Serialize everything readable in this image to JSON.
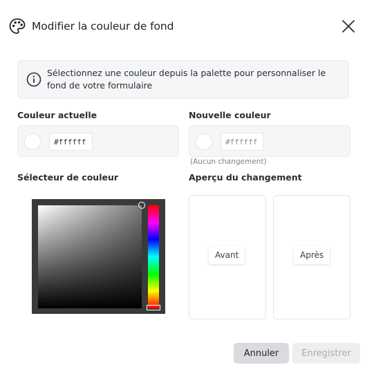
{
  "dialog": {
    "title": "Modifier la couleur de fond",
    "info_text": "Sélectionnez une couleur depuis la palette pour personnaliser le fond de votre formulaire",
    "icons": {
      "title": "palette-icon",
      "close": "close-icon",
      "info": "info-icon"
    }
  },
  "current": {
    "label": "Couleur actuelle",
    "hex": "#ffffff",
    "swatch_color": "#ffffff"
  },
  "new": {
    "label": "Nouvelle couleur",
    "hex": "#ffffff",
    "swatch_color": "#ffffff",
    "note": "(Aucun changement)"
  },
  "picker": {
    "label": "Sélecteur de couleur",
    "hue_color": "#ff0000"
  },
  "preview": {
    "label": "Aperçu du changement",
    "before": "Avant",
    "after": "Après"
  },
  "buttons": {
    "cancel": "Annuler",
    "save": "Enregistrer"
  }
}
